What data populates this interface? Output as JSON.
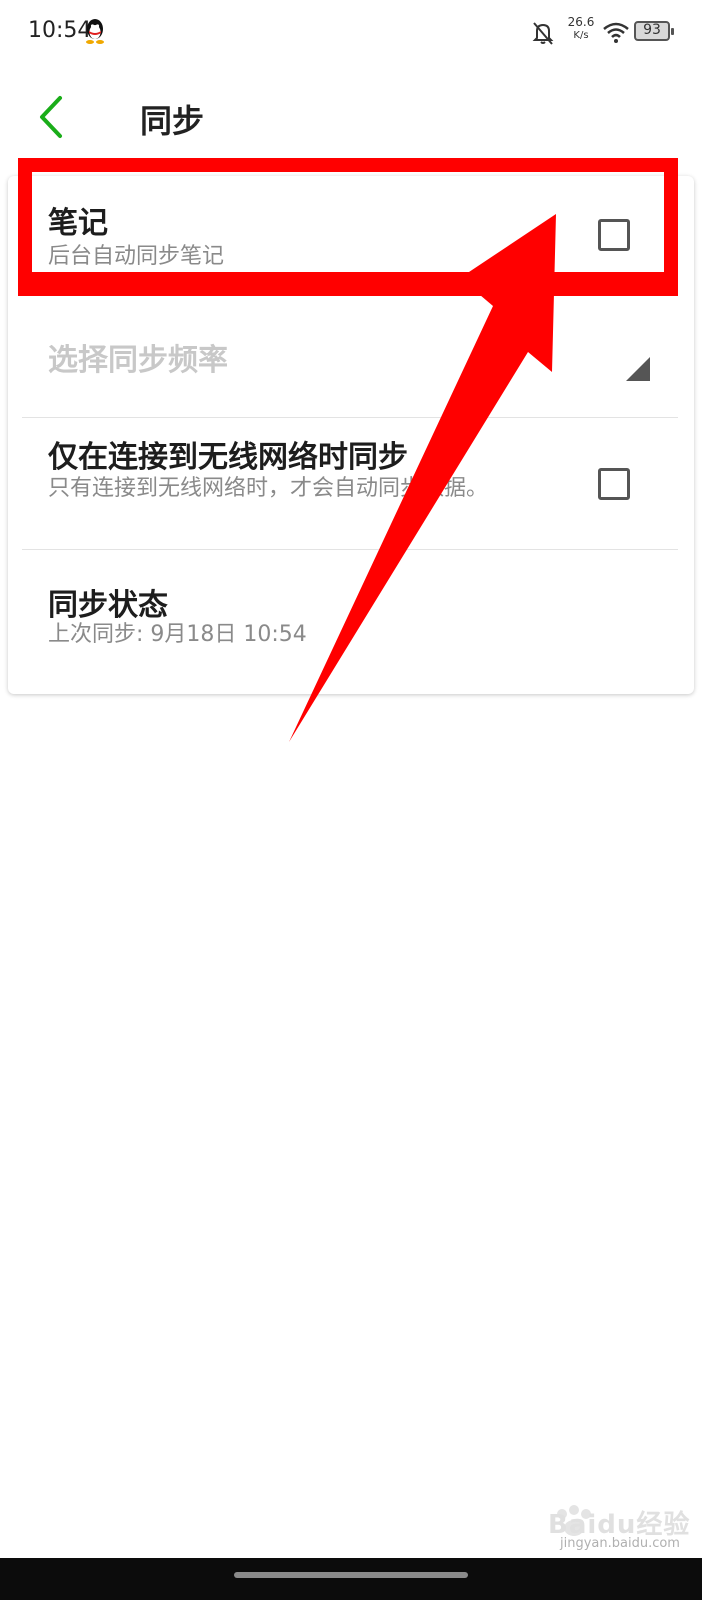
{
  "status_bar": {
    "time": "10:54",
    "net_speed_value": "26.6",
    "net_speed_unit": "K/s",
    "battery_level": "93",
    "icons": [
      "qq-penguin-icon",
      "bell-off-icon",
      "wifi-icon",
      "battery-icon"
    ]
  },
  "header": {
    "title": "同步",
    "back_icon": "chevron-left-icon",
    "back_icon_color": "#1aad19"
  },
  "settings": {
    "note": {
      "title": "笔记",
      "subtitle": "后台自动同步笔记",
      "checked": false
    },
    "frequency": {
      "title": "选择同步频率",
      "enabled": false
    },
    "wifi_only": {
      "title": "仅在连接到无线网络时同步",
      "subtitle": "只有连接到无线网络时，才会自动同步数据。",
      "checked": false
    },
    "sync_status": {
      "title": "同步状态",
      "subtitle": "上次同步: 9月18日 10:54"
    }
  },
  "annotation": {
    "color": "#ff0000"
  },
  "watermark": {
    "brand": "Baidu经验",
    "url": "jingyan.baidu.com"
  }
}
